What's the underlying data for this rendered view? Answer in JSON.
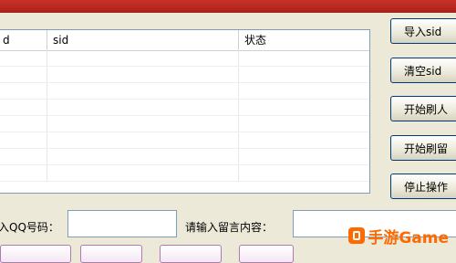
{
  "window": {
    "title": ""
  },
  "list": {
    "columns": [
      "d",
      "sid",
      "状态"
    ],
    "row_count": 8
  },
  "buttons": {
    "import_sid": "导入sid",
    "clear_sid": "清空sid",
    "start_brush_1": "开始刷人",
    "start_brush_2": "开始刷留",
    "stop_operation": "停止操作"
  },
  "form": {
    "qq_label": "入QQ号码：",
    "qq_value": "",
    "message_label": "请输入留言内容：",
    "message_value": ""
  },
  "bottom_buttons": [
    "",
    "",
    "",
    ""
  ],
  "watermark": {
    "text": "手游Game",
    "color": "#ff6a00"
  }
}
